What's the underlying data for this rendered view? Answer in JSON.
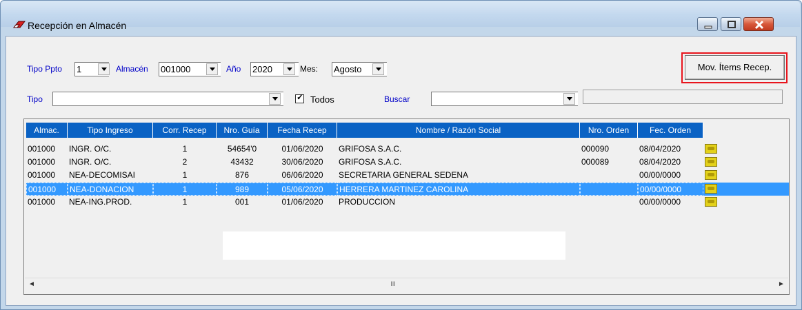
{
  "window": {
    "title": "Recepción en Almacén"
  },
  "filters": {
    "tipo_ppto_label": "Tipo Ppto",
    "tipo_ppto_value": "1",
    "almacen_label": "Almacén",
    "almacen_value": "001000",
    "anio_label": "Año",
    "anio_value": "2020",
    "mes_label": "Mes:",
    "mes_value": "Agosto",
    "tipo_label": "Tipo",
    "tipo_value": "",
    "todos_label": "Todos",
    "todos_checked": true,
    "buscar_label": "Buscar",
    "buscar_value": "",
    "mov_button": "Mov. Ítems Recep."
  },
  "grid": {
    "columns": [
      "Almac.",
      "Tipo Ingreso",
      "Corr. Recep",
      "Nro. Guía",
      "Fecha Recep",
      "Nombre / Razón Social",
      "Nro. Orden",
      "Fec. Orden"
    ],
    "rows": [
      {
        "almac": "001000",
        "tipo": "INGR. O/C.",
        "corr": "1",
        "guia": "54654'0",
        "fecha": "01/06/2020",
        "nombre": "GRIFOSA S.A.C.",
        "orden": "000090",
        "fec_orden": "08/04/2020",
        "selected": false
      },
      {
        "almac": "001000",
        "tipo": "INGR. O/C.",
        "corr": "2",
        "guia": "43432",
        "fecha": "30/06/2020",
        "nombre": "GRIFOSA S.A.C.",
        "orden": "000089",
        "fec_orden": "08/04/2020",
        "selected": false
      },
      {
        "almac": "001000",
        "tipo": "NEA-DECOMISAI",
        "corr": "1",
        "guia": "876",
        "fecha": "06/06/2020",
        "nombre": "SECRETARIA GENERAL SEDENA",
        "orden": "",
        "fec_orden": "00/00/0000",
        "selected": false
      },
      {
        "almac": "001000",
        "tipo": "NEA-DONACION",
        "corr": "1",
        "guia": "989",
        "fecha": "05/06/2020",
        "nombre": "HERRERA MARTINEZ CAROLINA",
        "orden": "",
        "fec_orden": "00/00/0000",
        "selected": true
      },
      {
        "almac": "001000",
        "tipo": "NEA-ING.PROD.",
        "corr": "1",
        "guia": "001",
        "fecha": "01/06/2020",
        "nombre": "PRODUCCION",
        "orden": "",
        "fec_orden": "00/00/0000",
        "selected": false
      }
    ]
  },
  "scrollbar": {
    "thumb_glyph": "III",
    "left_arrow": "◄",
    "right_arrow": "►"
  },
  "colors": {
    "header_bg": "#0a62c4",
    "selected_row": "#3399ff",
    "label_blue": "#0000c8",
    "highlight_frame": "#e8141c"
  }
}
